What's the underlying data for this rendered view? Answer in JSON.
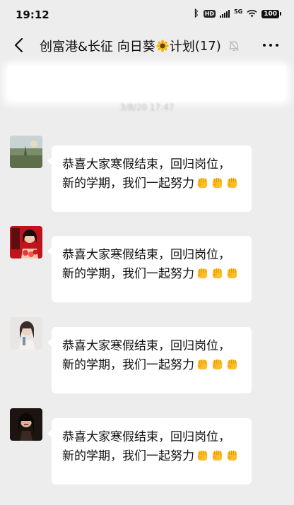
{
  "status_bar": {
    "time": "19:12",
    "hd_label": "HD",
    "network_label": "5G",
    "battery": "100"
  },
  "header": {
    "title": "创富港&长征 向日葵",
    "title_suffix": "计划",
    "member_count": "(17)",
    "icons": [
      "back-icon",
      "sunflower-icon",
      "mute-bell-icon",
      "more-icon"
    ]
  },
  "pinned_notice": {
    "note": "blurred / unreadable in screenshot"
  },
  "timestamp": "3/8/20 17:47",
  "messages": [
    {
      "avatar": "avatar-outdoor-landscape",
      "text": "恭喜大家寒假结束，回归岗位，新的学期，我们一起努力",
      "emoji": [
        "raised-fist-emoji",
        "raised-fist-emoji",
        "raised-fist-emoji"
      ]
    },
    {
      "avatar": "avatar-woman-red-flowers",
      "text": "恭喜大家寒假结束，回归岗位，新的学期，我们一起努力",
      "emoji": [
        "raised-fist-emoji",
        "raised-fist-emoji",
        "raised-fist-emoji"
      ]
    },
    {
      "avatar": "avatar-woman-portrait",
      "text": "恭喜大家寒假结束，回归岗位，新的学期，我们一起努力",
      "emoji": [
        "raised-fist-emoji",
        "raised-fist-emoji",
        "raised-fist-emoji"
      ]
    },
    {
      "avatar": "avatar-dark-portrait",
      "text": "恭喜大家寒假结束，回归岗位，新的学期，我们一起努力",
      "emoji": [
        "raised-fist-emoji",
        "raised-fist-emoji",
        "raised-fist-emoji"
      ]
    }
  ],
  "colors": {
    "background": "#ededed",
    "bubble": "#ffffff",
    "text": "#111111"
  }
}
